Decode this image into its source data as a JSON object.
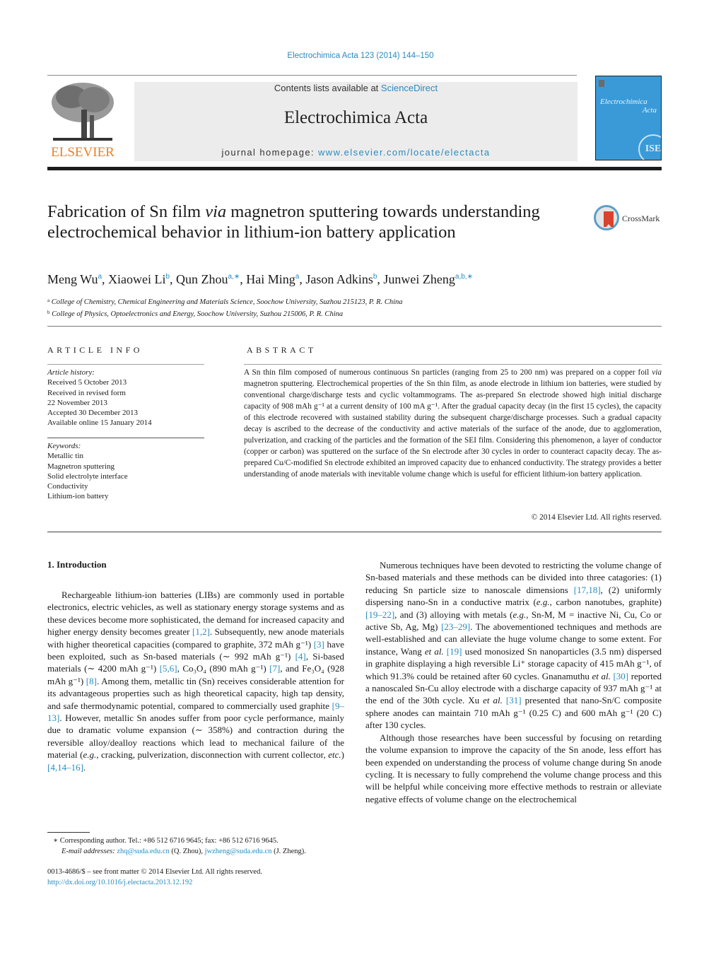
{
  "running_head": "Electrochimica Acta 123 (2014) 144–150",
  "masthead": {
    "contents_prefix": "Contents lists available at ",
    "contents_link": "ScienceDirect",
    "journal_name": "Electrochimica Acta",
    "homepage_prefix": "journal homepage: ",
    "homepage_link": "www.elsevier.com/locate/electacta",
    "publisher_logo_text": "ELSEVIER",
    "cover_title_line1": "Electrochimica",
    "cover_title_line2": "Acta",
    "cover_seal": "ISE",
    "brand_color": "#f07f1e",
    "link_color": "#2a8bbf"
  },
  "article": {
    "title_part1": "Fabrication of Sn film ",
    "title_italic": "via",
    "title_part2": " magnetron sputtering towards understanding electrochemical behavior in lithium-ion battery application",
    "crossmark_label": "CrossMark",
    "authors": [
      {
        "name": "Meng Wu",
        "sup": "a"
      },
      {
        "name": "Xiaowei Li",
        "sup": "b"
      },
      {
        "name": "Qun Zhou",
        "sup": "a,∗"
      },
      {
        "name": "Hai Ming",
        "sup": "a"
      },
      {
        "name": "Jason Adkins",
        "sup": "b"
      },
      {
        "name": "Junwei Zheng",
        "sup": "a,b,∗"
      }
    ],
    "affiliations": [
      {
        "key": "a",
        "text": "College of Chemistry, Chemical Engineering and Materials Science, Soochow University, Suzhou 215123, P. R. China"
      },
      {
        "key": "b",
        "text": "College of Physics, Optoelectronics and Energy, Soochow University, Suzhou 215006, P. R. China"
      }
    ]
  },
  "article_info": {
    "heading": "ARTICLE INFO",
    "history_label": "Article history:",
    "history": [
      "Received 5 October 2013",
      "Received in revised form",
      "22 November 2013",
      "Accepted 30 December 2013",
      "Available online 15 January 2014"
    ],
    "keywords_label": "Keywords:",
    "keywords": [
      "Metallic tin",
      "Magnetron sputtering",
      "Solid electrolyte interface",
      "Conductivity",
      "Lithium-ion battery"
    ]
  },
  "abstract": {
    "heading": "ABSTRACT",
    "p1": "A Sn thin film composed of numerous continuous Sn particles (ranging from 25 to 200 nm) was prepared on a copper foil ",
    "p1_italic": "via",
    "p2": " magnetron sputtering. Electrochemical properties of the Sn thin film, as anode electrode in lithium ion batteries, were studied by conventional charge/discharge tests and cyclic voltammograms. The as-prepared Sn electrode showed high initial discharge capacity of 908 mAh g⁻¹ at a current density of 100 mA g⁻¹. After the gradual capacity decay (in the first 15 cycles), the capacity of this electrode recovered with sustained stability during the subsequent charge/discharge processes. Such a gradual capacity decay is ascribed to the decrease of the conductivity and active materials of the surface of the anode, due to agglomeration, pulverization, and cracking of the particles and the formation of the SEI film. Considering this phenomenon, a layer of conductor (copper or carbon) was sputtered on the surface of the Sn electrode after 30 cycles in order to counteract capacity decay. The as-prepared Cu/C-modified Sn electrode exhibited an improved capacity due to enhanced conductivity. The strategy provides a better understanding of anode materials with inevitable volume change which is useful for efficient lithium-ion battery application.",
    "copyright": "© 2014 Elsevier Ltd. All rights reserved."
  },
  "body": {
    "section_heading": "1.  Introduction",
    "left_p1": [
      {
        "t": "Rechargeable lithium-ion batteries (LIBs) are commonly used in portable electronics, electric vehicles, as well as stationary energy storage systems and as these devices become more sophisticated, the demand for increased capacity and higher energy density becomes greater "
      },
      {
        "ref": "[1,2]"
      },
      {
        "t": ". Subsequently, new anode materials with higher theoretical capacities (compared to graphite, 372 mAh g⁻¹) "
      },
      {
        "ref": "[3]"
      },
      {
        "t": " have been exploited, such as Sn-based materials (∼ 992 mAh g⁻¹) "
      },
      {
        "ref": "[4]"
      },
      {
        "t": ", Si-based materials (∼ 4200 mAh g⁻¹) "
      },
      {
        "ref": "[5,6]"
      },
      {
        "t": ", Co₃O₄ (890 mAh g⁻¹) "
      },
      {
        "ref": "[7]"
      },
      {
        "t": ", and Fe₃O₄ (928 mAh g⁻¹) "
      },
      {
        "ref": "[8]"
      },
      {
        "t": ". Among them, metallic tin (Sn) receives considerable attention for its advantageous properties such as high theoretical capacity, high tap density, and safe thermodynamic potential, compared to commercially used graphite "
      },
      {
        "ref": "[9–13]"
      },
      {
        "t": ". However, metallic Sn anodes suffer from poor cycle performance, mainly due to dramatic volume expansion (∼ 358%) and contraction during the reversible alloy/dealloy reactions which lead to mechanical failure of the material ("
      },
      {
        "i": "e.g."
      },
      {
        "t": ", cracking, pulverization, disconnection with current collector, "
      },
      {
        "i": "etc."
      },
      {
        "t": ") "
      },
      {
        "ref": "[4,14–16]"
      },
      {
        "t": "."
      }
    ],
    "right_p1": [
      {
        "t": "Numerous techniques have been devoted to restricting the volume change of Sn-based materials and these methods can be divided into three catagories: (1) reducing Sn particle size to nanoscale dimensions "
      },
      {
        "ref": "[17,18]"
      },
      {
        "t": ", (2) uniformly dispersing nano-Sn in a conductive matrix ("
      },
      {
        "i": "e.g."
      },
      {
        "t": ", carbon nanotubes, graphite) "
      },
      {
        "ref": "[19–22]"
      },
      {
        "t": ", and (3) alloying with metals ("
      },
      {
        "i": "e.g."
      },
      {
        "t": ", Sn-M, M = inactive Ni, Cu, Co or active Sb, Ag, Mg) "
      },
      {
        "ref": "[23–29]"
      },
      {
        "t": ". The abovementioned techniques and methods are well-established and can alleviate the huge volume change to some extent. For instance, Wang "
      },
      {
        "i": "et al."
      },
      {
        "t": " "
      },
      {
        "ref": "[19]"
      },
      {
        "t": " used monosized Sn nanoparticles (3.5 nm) dispersed in graphite displaying a high reversible Li⁺ storage capacity of 415 mAh g⁻¹, of which 91.3% could be retained after 60 cycles. Gnanamuthu "
      },
      {
        "i": "et al."
      },
      {
        "t": " "
      },
      {
        "ref": "[30]"
      },
      {
        "t": " reported a nanoscaled Sn-Cu alloy electrode with a discharge capacity of 937 mAh g⁻¹ at the end of the 30th cycle. Xu "
      },
      {
        "i": "et al."
      },
      {
        "t": " "
      },
      {
        "ref": "[31]"
      },
      {
        "t": " presented that nano-Sn/C composite sphere anodes can maintain 710 mAh g⁻¹ (0.25 C) and 600 mAh g⁻¹ (20 C) after 130 cycles."
      }
    ],
    "right_p2": [
      {
        "t": "Although those researches have been successful by focusing on retarding the volume expansion to improve the capacity of the Sn anode, less effort has been expended on understanding the process of volume change during Sn anode cycling. It is necessary to fully comprehend the volume change process and this will be helpful while conceiving more effective methods to restrain or alleviate negative effects of volume change on the electrochemical"
      }
    ]
  },
  "footnotes": {
    "corresponding": "∗  Corresponding author. Tel.: +86 512 6716 9645; fax: +86 512 6716 9645.",
    "email_label": "E-mail addresses: ",
    "email1": "zhq@suda.edu.cn",
    "email1_owner": " (Q. Zhou), ",
    "email2": "jwzheng@suda.edu.cn",
    "email2_owner": " (J. Zheng)."
  },
  "issn": {
    "line": "0013-4686/$ – see front matter © 2014 Elsevier Ltd. All rights reserved.",
    "doi": "http://dx.doi.org/10.1016/j.electacta.2013.12.192"
  }
}
